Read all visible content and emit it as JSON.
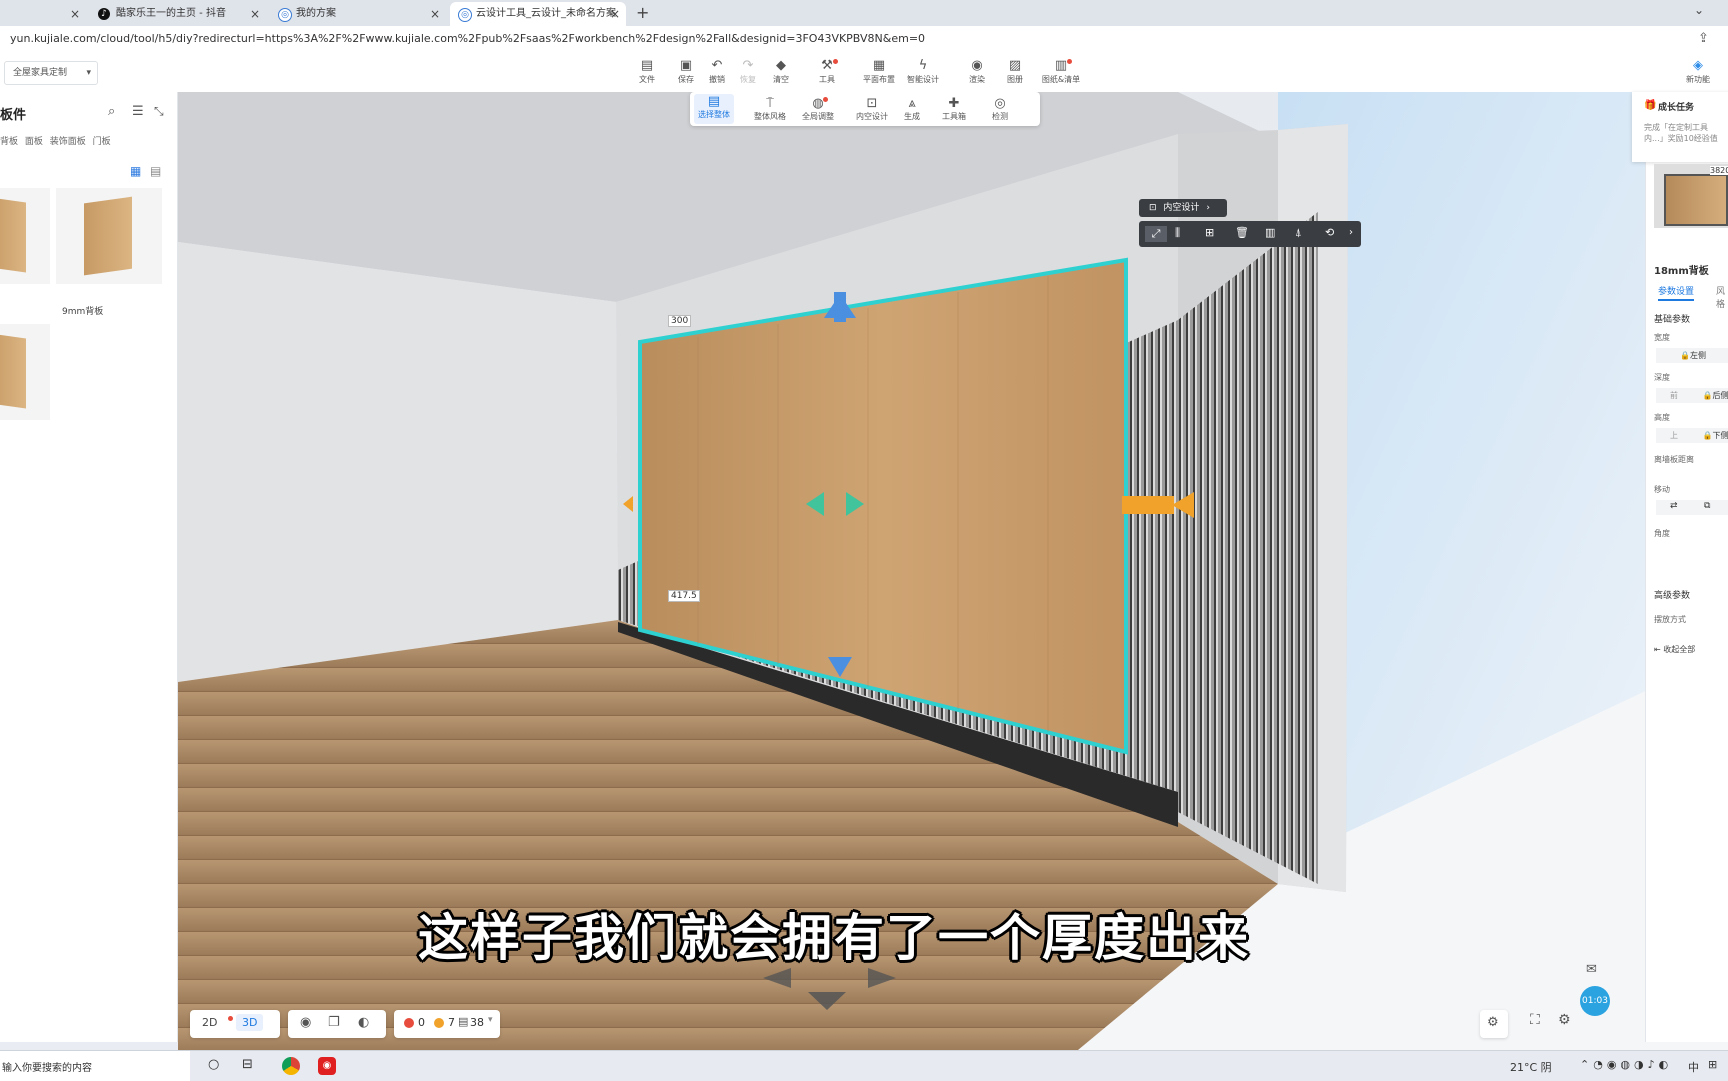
{
  "browser": {
    "tabs": [
      {
        "title": "酷家乐王一的主页 - 抖音",
        "icon": "douyin-icon"
      },
      {
        "title": "我的方案",
        "icon": "kujiale-icon"
      },
      {
        "title": "云设计工具_云设计_未命名方案",
        "icon": "kujiale-icon",
        "active": true
      }
    ],
    "new_tab_label": "+",
    "url": "yun.kujiale.com/cloud/tool/h5/diy?redirecturl=https%3A%2F%2Fwww.kujiale.com%2Fpub%2Fsaas%2Fworkbench%2Fdesign%2Fall&designid=3FO43VKPBV8N&em=0"
  },
  "app": {
    "mode_select": "全屋家具定制",
    "toolbar": [
      {
        "label": "文件",
        "icon": "file-icon"
      },
      {
        "label": "保存",
        "icon": "save-icon"
      },
      {
        "label": "撤销",
        "icon": "undo-icon"
      },
      {
        "label": "恢复",
        "icon": "redo-icon"
      },
      {
        "label": "清空",
        "icon": "eraser-icon"
      },
      {
        "label": "工具",
        "icon": "wrench-icon"
      },
      {
        "label": "平面布置",
        "icon": "floorplan-icon"
      },
      {
        "label": "智能设计",
        "icon": "lightning-icon"
      },
      {
        "label": "渲染",
        "icon": "camera-icon"
      },
      {
        "label": "图册",
        "icon": "album-icon"
      },
      {
        "label": "图纸&清单",
        "icon": "drawing-list-icon"
      }
    ],
    "new_feature_label": "新功能"
  },
  "left_panel": {
    "title": "板件",
    "categories": [
      "背板",
      "面板",
      "装饰面板",
      "门板"
    ],
    "items": [
      {
        "label": ""
      },
      {
        "label": "9mm背板"
      },
      {
        "label": ""
      }
    ]
  },
  "sub_toolbar": [
    {
      "label": "选择整体",
      "icon": "select-icon"
    },
    {
      "label": "整体风格",
      "icon": "paint-roller-icon"
    },
    {
      "label": "全局调整",
      "icon": "global-adjust-icon"
    },
    {
      "label": "内空设计",
      "icon": "inner-space-icon"
    },
    {
      "label": "生成",
      "icon": "generate-icon"
    },
    {
      "label": "工具箱",
      "icon": "toolbox-icon"
    },
    {
      "label": "检测",
      "icon": "inspect-icon"
    }
  ],
  "context": {
    "inner_design_label": "内空设计",
    "tool_icons": [
      "resize-icon",
      "align-icon",
      "add-icon",
      "delete-icon",
      "split-icon",
      "brush-icon",
      "rotate-icon"
    ]
  },
  "dimensions": {
    "top": "300",
    "bottom": "417.5"
  },
  "right_panel": {
    "growth_task_title": "成长任务",
    "growth_task_text": "完成「在定制工具内...」奖励10经验值",
    "thumb_value": "3820",
    "object_title": "18mm背板",
    "tabs": [
      "参数设置",
      "风格"
    ],
    "section_basic": "基础参数",
    "width_label": "宽度",
    "width_lock": "左侧",
    "depth_label": "深度",
    "depth_front": "前",
    "depth_lock": "后侧",
    "height_label": "高度",
    "height_up": "上",
    "height_lock": "下侧",
    "back_distance_label": "离墙板距离",
    "move_label": "移动",
    "angle_label": "角度",
    "section_advanced": "高级参数",
    "placement_label": "摆放方式",
    "collapse_label": "收起全部"
  },
  "bottom_bar": {
    "view_2d": "2D",
    "view_3d": "3D",
    "error_count": "0",
    "warning_count": "7",
    "item_count": "38"
  },
  "subtitle": "这样子我们就会拥有了一个厚度出来",
  "timer": "01:03",
  "taskbar": {
    "search_placeholder": "输入你要搜索的内容",
    "weather": "21°C 阴",
    "ime": "中"
  },
  "colors": {
    "selection": "#2fd0d0",
    "accent": "#1f7ae0",
    "wood": "#c79a64"
  }
}
